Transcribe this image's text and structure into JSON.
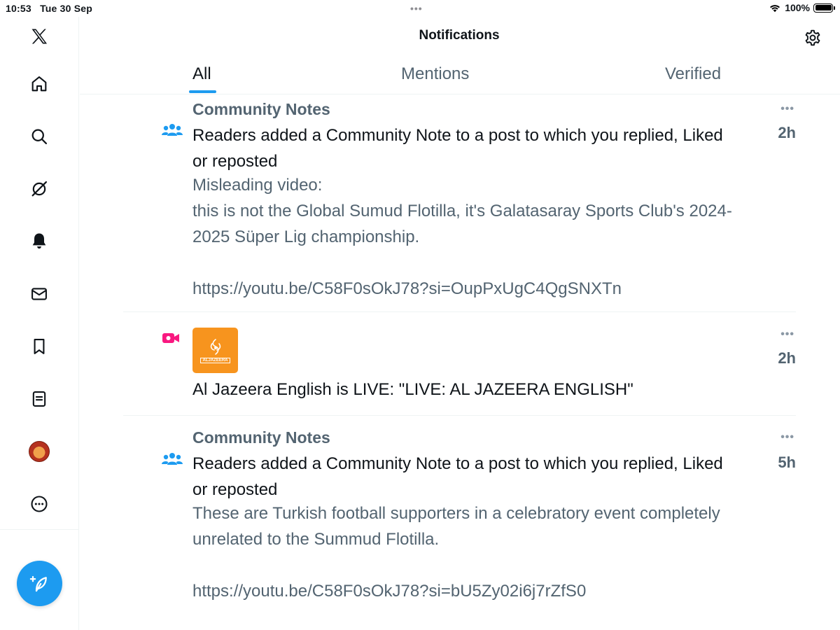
{
  "status_bar": {
    "time": "10:53",
    "date": "Tue 30 Sep",
    "multitask_dots": "•••",
    "battery_percent": "100%"
  },
  "header": {
    "title": "Notifications"
  },
  "tabs": [
    {
      "label": "All",
      "active": true
    },
    {
      "label": "Mentions",
      "active": false
    },
    {
      "label": "Verified",
      "active": false
    }
  ],
  "notifications": [
    {
      "icon": "community-notes-icon",
      "title": "Community Notes",
      "body": "Readers added a Community Note to a post to which you replied, Liked or reposted",
      "note": "Misleading video:\nthis is not the Global Sumud Flotilla, it's Galatasaray Sports Club's 2024-2025 Süper Lig championship.\n\nhttps://youtu.be/C58F0sOkJ78?si=OupPxUgC4QgSNXTn",
      "time": "2h",
      "more": "•••"
    },
    {
      "icon": "live-video-icon",
      "avatar": "al-jazeera-logo",
      "avatar_text": "ALJAZEERA",
      "body": "Al Jazeera English is LIVE: \"LIVE: AL JAZEERA ENGLISH\"",
      "time": "2h",
      "more": "•••"
    },
    {
      "icon": "community-notes-icon",
      "title": "Community Notes",
      "body": "Readers added a Community Note to a post to which you replied, Liked or reposted",
      "note": "These are Turkish football supporters in a celebratory event completely unrelated to the Summud Flotilla.\n\nhttps://youtu.be/C58F0sOkJ78?si=bU5Zy02i6j7rZfS0",
      "time": "5h",
      "more": "•••"
    }
  ],
  "colors": {
    "accent": "#1d9bf0",
    "secondary_text": "#536471",
    "live_pink": "#f91880",
    "aj_orange": "#f7941e"
  }
}
